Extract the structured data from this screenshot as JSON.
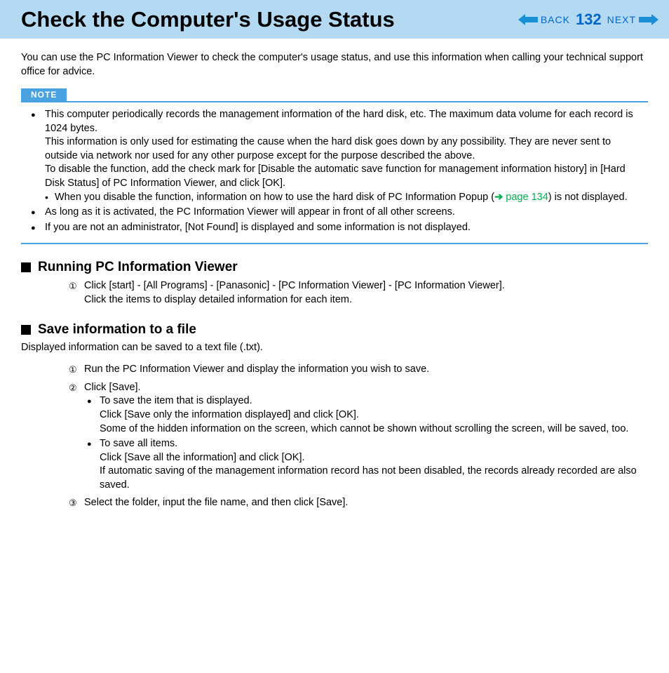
{
  "header": {
    "title": "Check the Computer's Usage Status",
    "back": "BACK",
    "page": "132",
    "next": "NEXT"
  },
  "intro": "You can use the PC Information Viewer to check the computer's usage status, and use this information when calling your technical support office for advice.",
  "note": {
    "label": "NOTE",
    "b1a": "This computer periodically records the management information of the hard disk, etc. The maximum data volume for each record is 1024 bytes.",
    "b1b": "This information is only used for estimating the cause when the hard disk goes down by any possibility. They are never sent to outside via network nor used for any other purpose except for the purpose described the above.",
    "b1c": "To disable the function, add the check mark for [Disable the automatic save function for management information history] in [Hard Disk Status] of PC Information Viewer, and click [OK].",
    "b1d_pre": "When you disable the function, information on how to use the hard disk of PC Information Popup (",
    "b1d_link": "page 134",
    "b1d_post": ") is not displayed.",
    "b2": "As long as it is activated, the PC Information Viewer will appear in front of all other screens.",
    "b3": "If you are not an administrator, [Not Found] is displayed and some information is not displayed."
  },
  "section1": {
    "title": "Running PC Information Viewer",
    "step1a": "Click [start] - [All Programs] - [Panasonic] - [PC Information Viewer] - [PC Information Viewer].",
    "step1b": "Click the items to display detailed information for each item."
  },
  "section2": {
    "title": "Save information to a file",
    "intro": "Displayed information can be saved to a text file (.txt).",
    "step1": "Run the PC Information Viewer and display the information you wish to save.",
    "step2": "Click [Save].",
    "s2a1": "To save the item that is displayed.",
    "s2a2": "Click [Save only the information displayed] and click [OK].",
    "s2a3": "Some of the hidden information on the screen, which cannot be shown without scrolling the screen, will be saved, too.",
    "s2b1": "To save all items.",
    "s2b2": "Click [Save all the information] and click [OK].",
    "s2b3": "If automatic saving of the management information record has not been disabled, the records already recorded are also saved.",
    "step3": "Select the folder, input the file name, and then click [Save]."
  },
  "circled": {
    "1": "①",
    "2": "②",
    "3": "③"
  }
}
